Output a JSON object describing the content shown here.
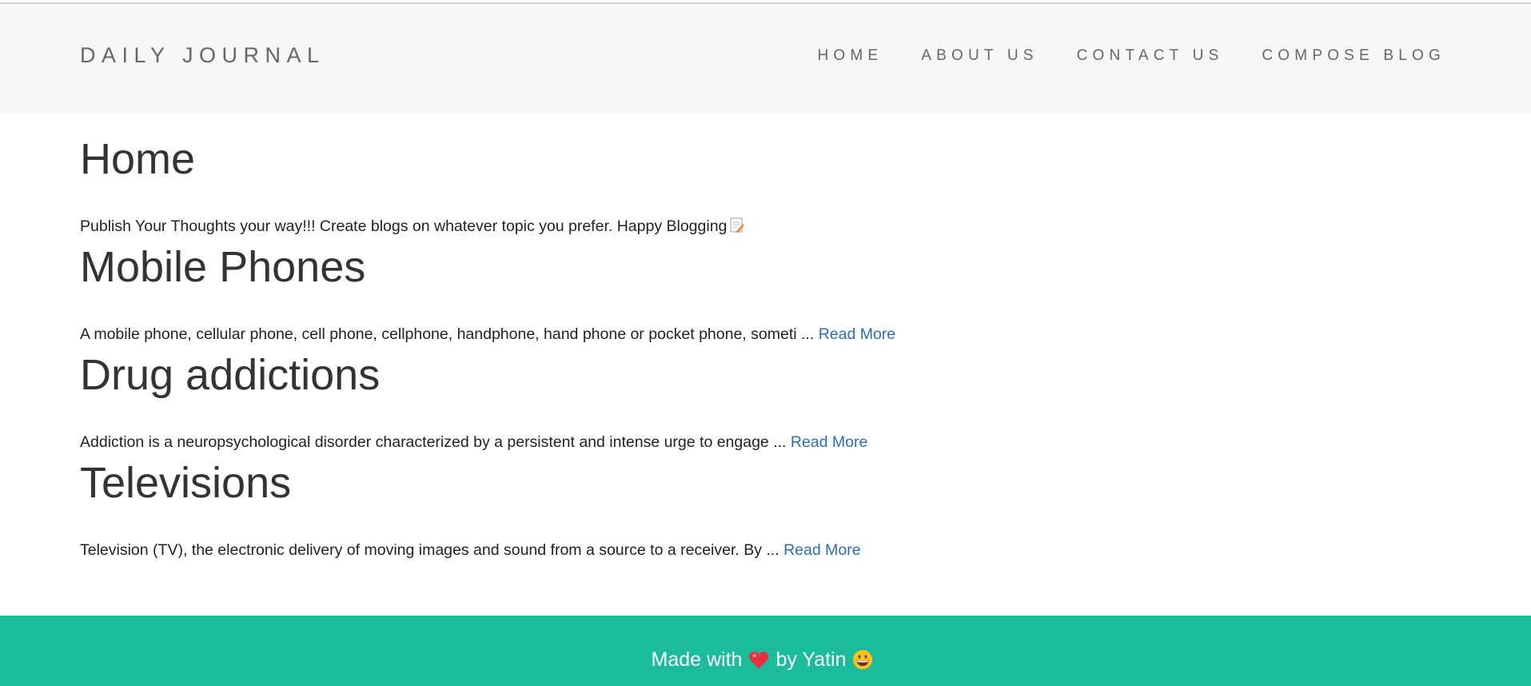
{
  "nav": {
    "brand": "DAILY JOURNAL",
    "links": [
      "HOME",
      "ABOUT US",
      "CONTACT US",
      "COMPOSE BLOG"
    ]
  },
  "home": {
    "title": "Home",
    "intro": "Publish Your Thoughts your way!!! Create blogs on whatever topic you prefer. Happy Blogging",
    "intro_icon": "memo-icon"
  },
  "posts": [
    {
      "title": "Mobile Phones",
      "excerpt": "A mobile phone, cellular phone, cell phone, cellphone, handphone, hand phone or pocket phone, someti ...",
      "link": "Read More"
    },
    {
      "title": "Drug addictions",
      "excerpt": "Addiction is a neuropsychological disorder characterized by a persistent and intense urge to engage ...",
      "link": "Read More"
    },
    {
      "title": "Televisions",
      "excerpt": "Television (TV), the electronic delivery of moving images and sound from a source to a receiver. By ...",
      "link": "Read More"
    }
  ],
  "footer": {
    "made_with": "Made with",
    "heart_icon": "heart-icon",
    "by": "by Yatin",
    "smile_icon": "grinning-face-icon"
  },
  "colors": {
    "navbar_bg": "#f7f7f7",
    "footer_bg": "#1abc9c",
    "link": "#2a6ebb",
    "heading": "#333333"
  }
}
